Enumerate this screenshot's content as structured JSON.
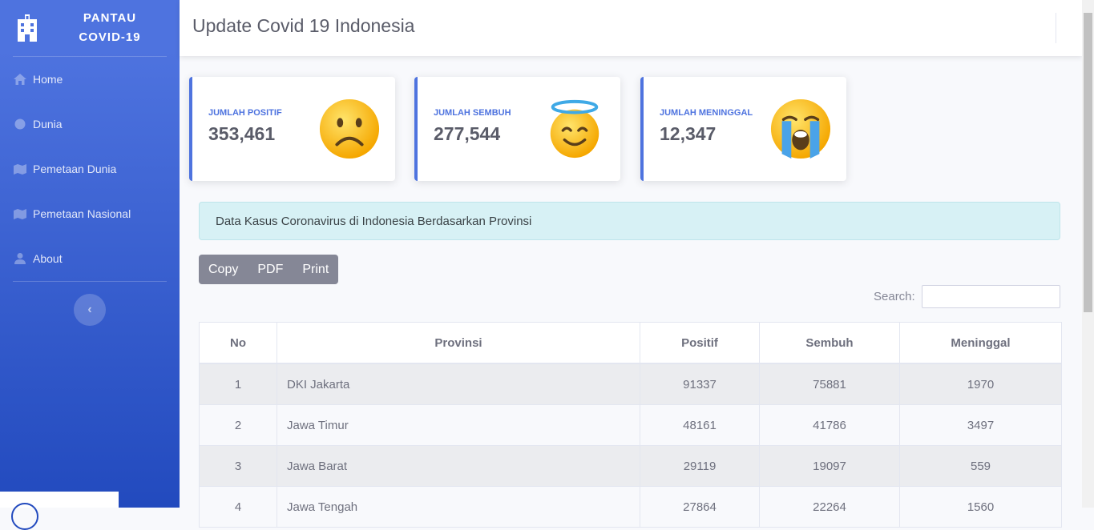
{
  "brand": {
    "line1": "PANTAU",
    "line2": "COVID-19"
  },
  "nav": [
    {
      "label": "Home",
      "icon": "home-icon"
    },
    {
      "label": "Dunia",
      "icon": "globe-icon"
    },
    {
      "label": "Pemetaan Dunia",
      "icon": "map-icon"
    },
    {
      "label": "Pemetaan Nasional",
      "icon": "map-icon"
    },
    {
      "label": "About",
      "icon": "user-icon"
    }
  ],
  "header": {
    "title": "Update Covid 19 Indonesia"
  },
  "cards": [
    {
      "label": "JUMLAH POSITIF",
      "value": "353,461",
      "icon": "frowning-face-emoji"
    },
    {
      "label": "JUMLAH SEMBUH",
      "value": "277,544",
      "icon": "smiling-face-with-halo-emoji"
    },
    {
      "label": "JUMLAH MENINGGAL",
      "value": "12,347",
      "icon": "loudly-crying-face-emoji"
    }
  ],
  "alert": "Data Kasus Coronavirus di Indonesia Berdasarkan Provinsi",
  "buttons": {
    "copy": "Copy",
    "pdf": "PDF",
    "print": "Print"
  },
  "search": {
    "label": "Search:",
    "placeholder": ""
  },
  "table": {
    "headers": [
      "No",
      "Provinsi",
      "Positif",
      "Sembuh",
      "Meninggal"
    ],
    "rows": [
      [
        "1",
        "DKI Jakarta",
        "91337",
        "75881",
        "1970"
      ],
      [
        "2",
        "Jawa Timur",
        "48161",
        "41786",
        "3497"
      ],
      [
        "3",
        "Jawa Barat",
        "29119",
        "19097",
        "559"
      ],
      [
        "4",
        "Jawa Tengah",
        "27864",
        "22264",
        "1560"
      ]
    ]
  },
  "colors": {
    "primary": "#4e73df",
    "sidebar_end": "#224abe",
    "alert_bg": "#d7f1f5",
    "button_bg": "#858796"
  }
}
